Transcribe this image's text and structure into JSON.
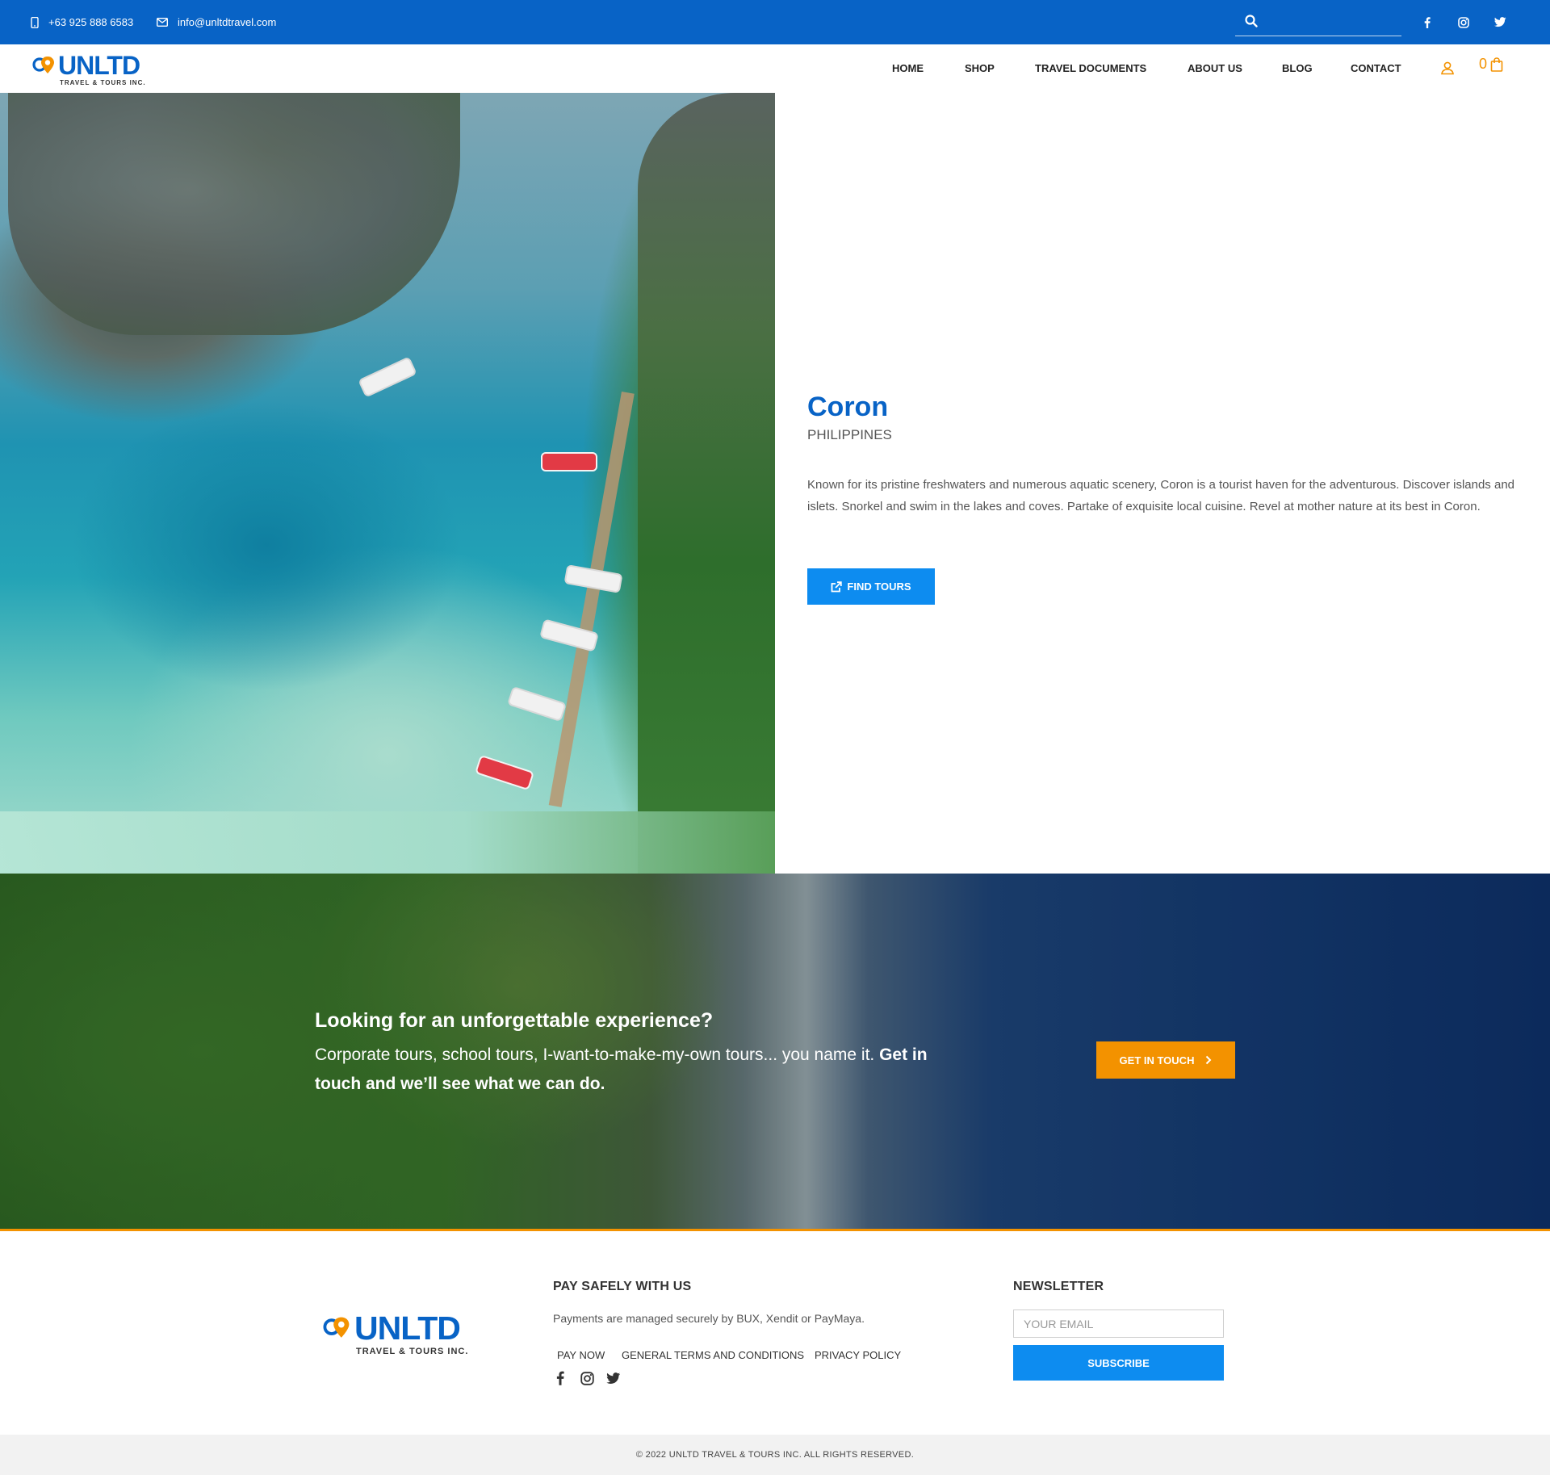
{
  "topbar": {
    "phone": "+63 925 888 6583",
    "email": "info@unltdtravel.com",
    "search_placeholder": "",
    "social": [
      "facebook-icon",
      "instagram-icon",
      "twitter-icon"
    ]
  },
  "brand": {
    "name": "UNLTD",
    "tagline": "TRAVEL & TOURS INC."
  },
  "nav": {
    "items": [
      "HOME",
      "SHOP",
      "TRAVEL DOCUMENTS",
      "ABOUT US",
      "BLOG",
      "CONTACT"
    ],
    "cart_count": "0"
  },
  "hero": {
    "title": "Coron",
    "country": "PHILIPPINES",
    "description": "Known for its pristine freshwaters and numerous aquatic scenery, Coron is a tourist haven for the adventurous. Discover islands and islets. Snorkel and swim in the lakes and coves. Partake of exquisite local cuisine. Revel at mother nature at its best in Coron.",
    "button": "FIND TOURS"
  },
  "cta": {
    "heading": "Looking for an unforgettable experience?",
    "body_plain": "Corporate tours, school tours, I-want-to-make-my-own tours...  you name it. ",
    "body_bold": "Get in touch and we’ll see what we can do.",
    "button": "GET IN TOUCH"
  },
  "footer": {
    "pay_title": "PAY SAFELY WITH US",
    "pay_text": "Payments are managed securely by BUX, Xendit or PayMaya.",
    "links": [
      "PAY NOW",
      "GENERAL TERMS AND CONDITIONS",
      "PRIVACY POLICY"
    ],
    "newsletter_title": "NEWSLETTER",
    "email_placeholder": "YOUR EMAIL",
    "subscribe": "SUBSCRIBE",
    "copyright": "© 2022 UNLTD TRAVEL & TOURS INC. ALL RIGHTS RESERVED."
  },
  "colors": {
    "primary_blue": "#0863c6",
    "button_blue": "#0d8cf0",
    "accent_orange": "#f39200"
  }
}
